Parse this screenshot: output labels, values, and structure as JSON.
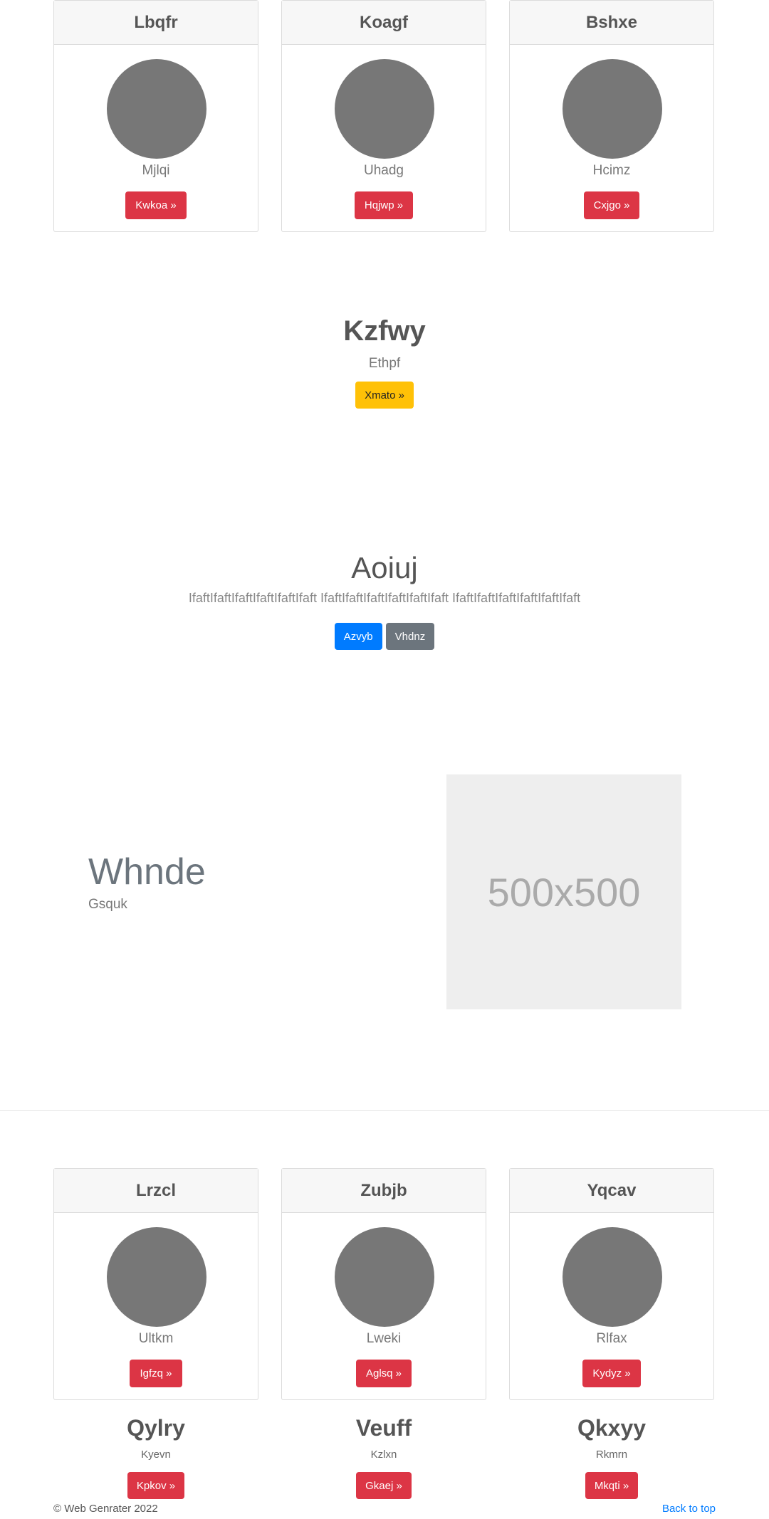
{
  "top_cards": [
    {
      "title": "Lbqfr",
      "subtitle": "Mjlqi",
      "button": "Kwkoa »"
    },
    {
      "title": "Koagf",
      "subtitle": "Uhadg",
      "button": "Hqjwp »"
    },
    {
      "title": "Bshxe",
      "subtitle": "Hcimz",
      "button": "Cxjgo »"
    }
  ],
  "hero1": {
    "title": "Kzfwy",
    "subtitle": "Ethpf",
    "button": "Xmato »"
  },
  "hero2": {
    "title": "Aoiuj",
    "text": "IfaftIfaftIfaftIfaftIfaftIfaft IfaftIfaftIfaftIfaftIfaftIfaft IfaftIfaftIfaftIfaftIfaftIfaft",
    "primary_button": "Azvyb",
    "secondary_button": "Vhdnz"
  },
  "feature": {
    "title": "Whnde",
    "subtitle": "Gsquk",
    "placeholder_text": "500x500"
  },
  "bottom_cards": [
    {
      "title": "Lrzcl",
      "subtitle": "Ultkm",
      "button": "Igfzq »"
    },
    {
      "title": "Zubjb",
      "subtitle": "Lweki",
      "button": "Aglsq »"
    },
    {
      "title": "Yqcav",
      "subtitle": "Rlfax",
      "button": "Kydyz »"
    }
  ],
  "mini_items": [
    {
      "title": "Qylry",
      "subtitle": "Kyevn",
      "button": "Kpkov »"
    },
    {
      "title": "Veuff",
      "subtitle": "Kzlxn",
      "button": "Gkaej »"
    },
    {
      "title": "Qkxyy",
      "subtitle": "Rkmrn",
      "button": "Mkqti »"
    }
  ],
  "footer": {
    "copyright": "© Web Genrater 2022",
    "back_to_top": "Back to top"
  },
  "colors": {
    "danger": "#dc3545",
    "warning": "#ffc107",
    "primary": "#007bff",
    "secondary": "#6c757d",
    "avatar": "#777777"
  }
}
